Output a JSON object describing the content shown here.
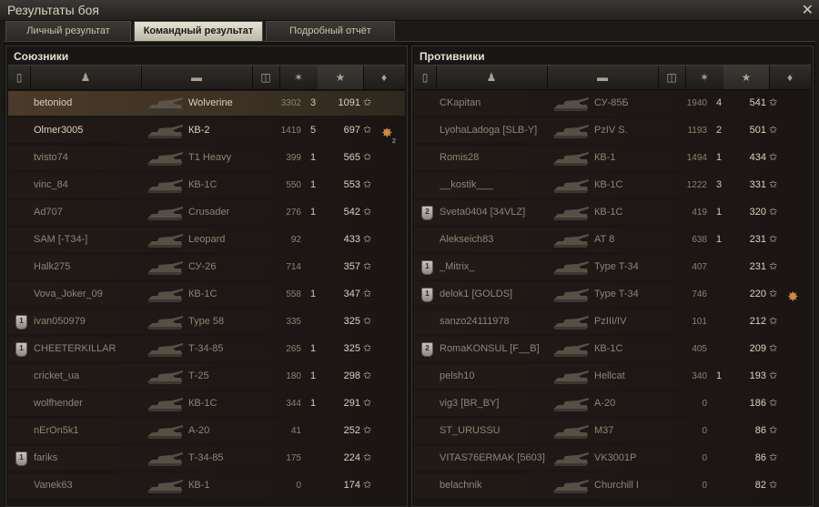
{
  "window": {
    "title": "Результаты боя",
    "close_icon": "close-icon"
  },
  "tabs": [
    {
      "label": "Личный результат",
      "active": false
    },
    {
      "label": "Командный результат",
      "active": true
    },
    {
      "label": "Подробный отчёт",
      "active": false
    }
  ],
  "allies": {
    "title": "Союзники",
    "rows": [
      {
        "name": "betoniod",
        "vehicle": "Wolverine",
        "damage": "3302",
        "kills": "3",
        "xp": "1091",
        "alive": true,
        "self": true,
        "medal": "",
        "achievement": ""
      },
      {
        "name": "Olmer3005",
        "vehicle": "КВ-2",
        "damage": "1419",
        "kills": "5",
        "xp": "697",
        "alive": true,
        "self": false,
        "medal": "",
        "achievement": "2"
      },
      {
        "name": "tvisto74",
        "vehicle": "T1 Heavy",
        "damage": "399",
        "kills": "1",
        "xp": "565",
        "alive": false,
        "self": false,
        "medal": "",
        "achievement": ""
      },
      {
        "name": "vinc_84",
        "vehicle": "КВ-1С",
        "damage": "550",
        "kills": "1",
        "xp": "553",
        "alive": false,
        "self": false,
        "medal": "",
        "achievement": ""
      },
      {
        "name": "Ad707",
        "vehicle": "Crusader",
        "damage": "276",
        "kills": "1",
        "xp": "542",
        "alive": false,
        "self": false,
        "medal": "",
        "achievement": ""
      },
      {
        "name": "SAM [-T34-]",
        "vehicle": "Leopard",
        "damage": "92",
        "kills": "",
        "xp": "433",
        "alive": false,
        "self": false,
        "medal": "",
        "achievement": ""
      },
      {
        "name": "Halk275",
        "vehicle": "СУ-26",
        "damage": "714",
        "kills": "",
        "xp": "357",
        "alive": false,
        "self": false,
        "medal": "",
        "achievement": ""
      },
      {
        "name": "Vova_Joker_09",
        "vehicle": "КВ-1С",
        "damage": "558",
        "kills": "1",
        "xp": "347",
        "alive": false,
        "self": false,
        "medal": "",
        "achievement": ""
      },
      {
        "name": "ivan050979",
        "vehicle": "Type 58",
        "damage": "335",
        "kills": "",
        "xp": "325",
        "alive": false,
        "self": false,
        "medal": "1",
        "achievement": ""
      },
      {
        "name": "CHEETERKILLAR",
        "vehicle": "Т-34-85",
        "damage": "265",
        "kills": "1",
        "xp": "325",
        "alive": false,
        "self": false,
        "medal": "1",
        "achievement": ""
      },
      {
        "name": "cricket_ua",
        "vehicle": "Т-25",
        "damage": "180",
        "kills": "1",
        "xp": "298",
        "alive": false,
        "self": false,
        "medal": "",
        "achievement": ""
      },
      {
        "name": "wolfhender",
        "vehicle": "КВ-1С",
        "damage": "344",
        "kills": "1",
        "xp": "291",
        "alive": false,
        "self": false,
        "medal": "",
        "achievement": ""
      },
      {
        "name": "nErOn5k1",
        "vehicle": "А-20",
        "damage": "41",
        "kills": "",
        "xp": "252",
        "alive": false,
        "self": false,
        "medal": "",
        "achievement": ""
      },
      {
        "name": "fariks",
        "vehicle": "Т-34-85",
        "damage": "175",
        "kills": "",
        "xp": "224",
        "alive": false,
        "self": false,
        "medal": "1",
        "achievement": ""
      },
      {
        "name": "Vanek63",
        "vehicle": "КВ-1",
        "damage": "0",
        "kills": "",
        "xp": "174",
        "alive": false,
        "self": false,
        "medal": "",
        "achievement": ""
      }
    ]
  },
  "enemies": {
    "title": "Противники",
    "rows": [
      {
        "name": "CKapitan",
        "vehicle": "СУ-85Б",
        "damage": "1940",
        "kills": "4",
        "xp": "541",
        "alive": false,
        "self": false,
        "medal": "",
        "achievement": ""
      },
      {
        "name": "LyohaLadoga [SLB-Y]",
        "vehicle": "PzIV S.",
        "damage": "1193",
        "kills": "2",
        "xp": "501",
        "alive": false,
        "self": false,
        "medal": "",
        "achievement": ""
      },
      {
        "name": "Romis28",
        "vehicle": "КВ-1",
        "damage": "1494",
        "kills": "1",
        "xp": "434",
        "alive": false,
        "self": false,
        "medal": "",
        "achievement": ""
      },
      {
        "name": "__kostik___",
        "vehicle": "КВ-1С",
        "damage": "1222",
        "kills": "3",
        "xp": "331",
        "alive": false,
        "self": false,
        "medal": "",
        "achievement": ""
      },
      {
        "name": "Sveta0404 [34VLZ]",
        "vehicle": "КВ-1С",
        "damage": "419",
        "kills": "1",
        "xp": "320",
        "alive": false,
        "self": false,
        "medal": "2",
        "achievement": ""
      },
      {
        "name": "Alekseich83",
        "vehicle": "AT 8",
        "damage": "638",
        "kills": "1",
        "xp": "231",
        "alive": false,
        "self": false,
        "medal": "",
        "achievement": ""
      },
      {
        "name": "_Mitrix_",
        "vehicle": "Type T-34",
        "damage": "407",
        "kills": "",
        "xp": "231",
        "alive": false,
        "self": false,
        "medal": "1",
        "achievement": ""
      },
      {
        "name": "delok1 [GOLDS]",
        "vehicle": "Type T-34",
        "damage": "746",
        "kills": "",
        "xp": "220",
        "alive": false,
        "self": false,
        "medal": "1",
        "achievement": "1"
      },
      {
        "name": "sanzo24111978",
        "vehicle": "PzIII/IV",
        "damage": "101",
        "kills": "",
        "xp": "212",
        "alive": false,
        "self": false,
        "medal": "",
        "achievement": ""
      },
      {
        "name": "RomaKONSUL [F__B]",
        "vehicle": "КВ-1С",
        "damage": "405",
        "kills": "",
        "xp": "209",
        "alive": false,
        "self": false,
        "medal": "2",
        "achievement": ""
      },
      {
        "name": "pelsh10",
        "vehicle": "Hellcat",
        "damage": "340",
        "kills": "1",
        "xp": "193",
        "alive": false,
        "self": false,
        "medal": "",
        "achievement": ""
      },
      {
        "name": "vig3 [BR_BY]",
        "vehicle": "А-20",
        "damage": "0",
        "kills": "",
        "xp": "186",
        "alive": false,
        "self": false,
        "medal": "",
        "achievement": ""
      },
      {
        "name": "ST_URUSSU",
        "vehicle": "M37",
        "damage": "0",
        "kills": "",
        "xp": "86",
        "alive": false,
        "self": false,
        "medal": "",
        "achievement": ""
      },
      {
        "name": "VITAS76ERMAK [5603]",
        "vehicle": "VK3001P",
        "damage": "0",
        "kills": "",
        "xp": "86",
        "alive": false,
        "self": false,
        "medal": "",
        "achievement": ""
      },
      {
        "name": "belachnik",
        "vehicle": "Churchill I",
        "damage": "0",
        "kills": "",
        "xp": "82",
        "alive": false,
        "self": false,
        "medal": "",
        "achievement": ""
      }
    ]
  },
  "columns": [
    "medal-icon",
    "player-icon",
    "vehicle-icon",
    "damage-icon",
    "kills-icon",
    "xp-star-icon",
    "achievement-icon"
  ]
}
